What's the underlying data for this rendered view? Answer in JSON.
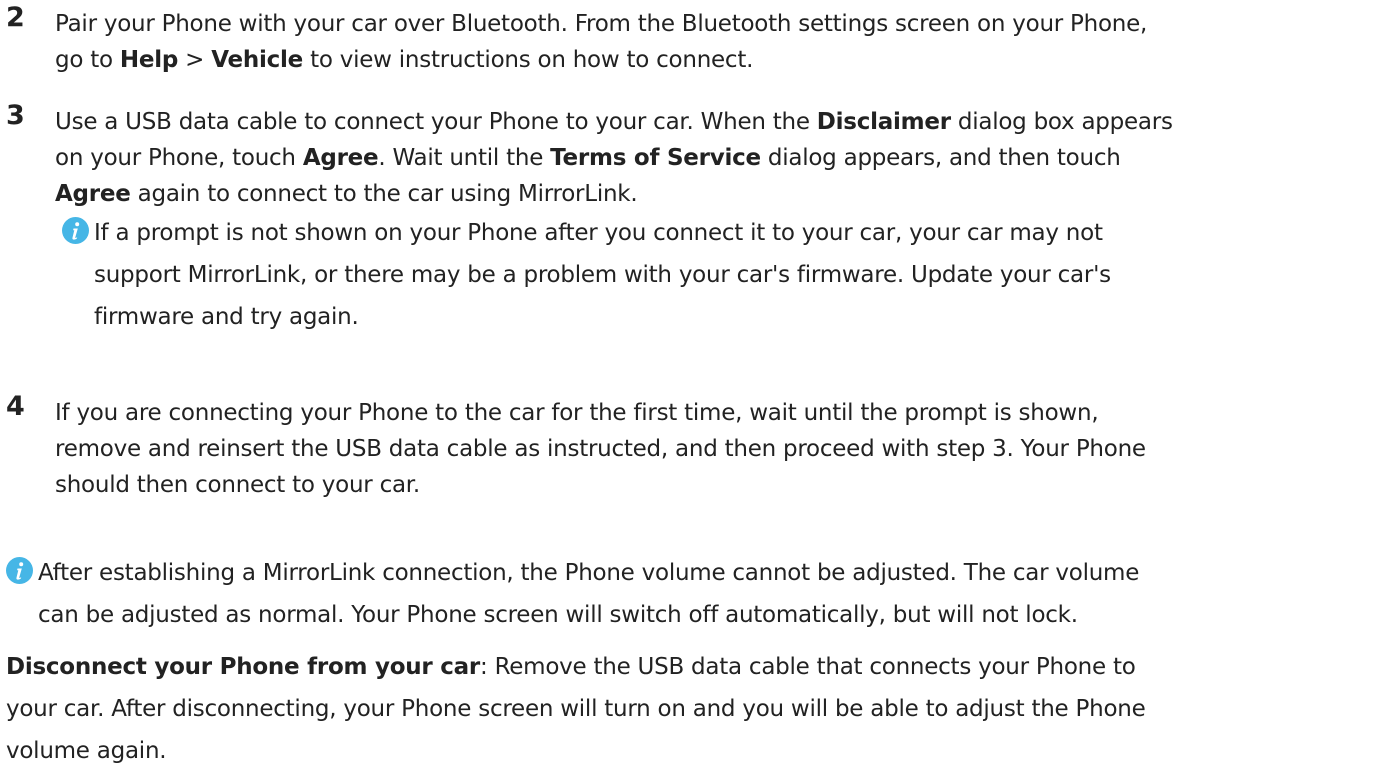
{
  "step2": {
    "number": "2",
    "line1": "Pair your Phone with your car over Bluetooth. From the Bluetooth settings screen on your Phone,",
    "line2_pre": "go to ",
    "help": "Help",
    "separator": " > ",
    "vehicle": "Vehicle",
    "line2_post": " to view instructions on how to connect."
  },
  "step3": {
    "number": "3",
    "line1_pre": "Use a USB data cable to connect your Phone to your car. When the ",
    "disclaimer": "Disclaimer",
    "line1_post": " dialog box appears",
    "line2_pre": "on your Phone, touch ",
    "agree1": "Agree",
    "line2_mid": ". Wait until the ",
    "terms": "Terms of Service",
    "line2_post": " dialog appears, and then touch",
    "agree2": "Agree",
    "line3_post": " again to connect to the car using MirrorLink.",
    "note": {
      "line1": "If a prompt is not shown on your Phone after you connect it to your car, your car may not",
      "line2": "support MirrorLink, or there may be a problem with your car's firmware. Update your car's",
      "line3": "firmware and try again."
    }
  },
  "step4": {
    "number": "4",
    "line1": "If you are connecting your Phone to the car for the first time, wait until the prompt is shown,",
    "line2": "remove and reinsert the USB data cable as instructed, and then proceed with step 3. Your Phone",
    "line3": "should then connect to your car."
  },
  "note2": {
    "line1": "After establishing a MirrorLink connection, the Phone volume cannot be adjusted. The car volume",
    "line2": "can be adjusted as normal. Your Phone screen will switch off automatically, but will not lock."
  },
  "disconnect": {
    "title": "Disconnect your Phone from your car",
    "line1_post": ": Remove the USB data cable that connects your Phone to",
    "line2": "your car. After disconnecting, your Phone screen will turn on and you will be able to adjust the Phone",
    "line3": "volume again."
  },
  "icons": {
    "info": "info-icon",
    "info_color": "#46b6e6"
  }
}
